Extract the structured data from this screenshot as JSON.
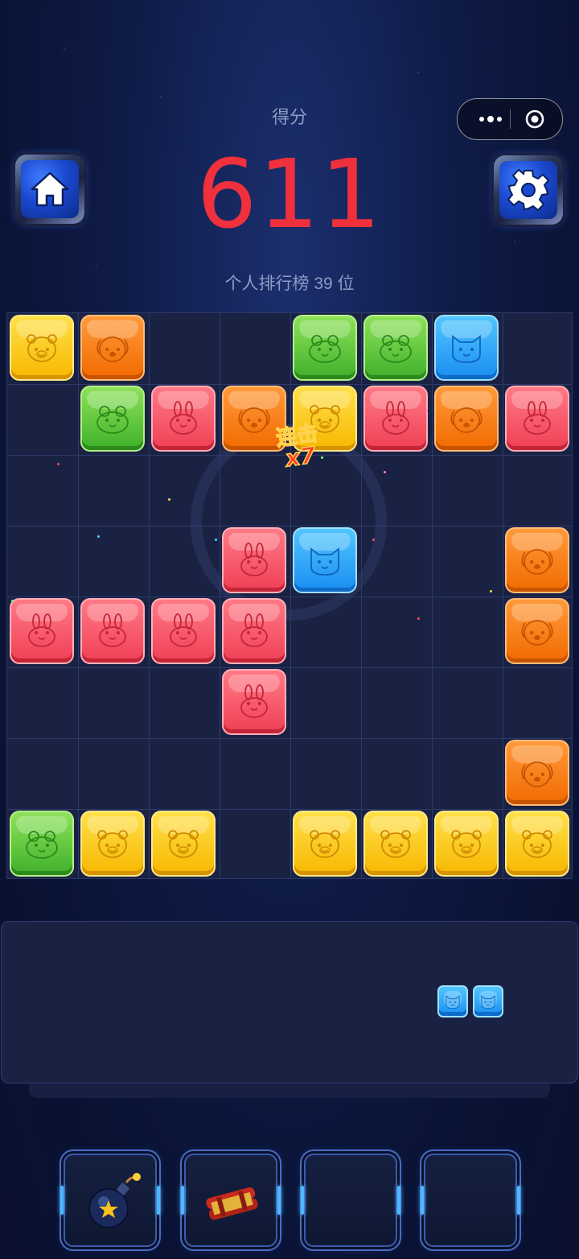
{
  "header": {
    "score_label": "得分",
    "score": "611",
    "rank_text": "个人排行榜 39 位",
    "score_color": "#f0303d"
  },
  "buttons": {
    "home_icon": "home-icon",
    "settings_icon": "gear-icon",
    "more_icon": "more-dots-icon",
    "close_icon": "target-circle-icon"
  },
  "board": {
    "rows": 8,
    "cols": 8,
    "cells": [
      [
        "yellow-bear",
        "orange-dog",
        null,
        null,
        "green-frog",
        "green-frog",
        "blue-cat",
        null
      ],
      [
        null,
        "green-frog",
        "red-rabbit",
        "orange-dog",
        "yellow-bear",
        "red-rabbit",
        "orange-dog",
        "red-rabbit"
      ],
      [
        null,
        null,
        null,
        null,
        null,
        null,
        null,
        null
      ],
      [
        null,
        null,
        null,
        "red-rabbit",
        "blue-cat",
        null,
        null,
        "orange-dog"
      ],
      [
        "red-rabbit",
        "red-rabbit",
        "red-rabbit",
        "red-rabbit",
        null,
        null,
        null,
        "orange-dog"
      ],
      [
        null,
        null,
        null,
        "red-rabbit",
        null,
        null,
        null,
        null
      ],
      [
        null,
        null,
        null,
        null,
        null,
        null,
        null,
        "orange-dog"
      ],
      [
        "green-frog",
        "yellow-bear",
        "yellow-bear",
        null,
        "yellow-bear",
        "yellow-bear",
        "yellow-bear",
        "yellow-bear"
      ]
    ],
    "combo": {
      "label": "连击",
      "multiplier": "x7"
    }
  },
  "tray": {
    "piece": [
      "blue-cat",
      "blue-cat"
    ]
  },
  "powerups": [
    {
      "name": "bomb",
      "icon": "bomb-icon"
    },
    {
      "name": "firecracker",
      "icon": "firecracker-icon"
    },
    {
      "name": "empty",
      "icon": null
    },
    {
      "name": "empty",
      "icon": null
    }
  ],
  "colors": {
    "yellow": "#f6b800",
    "orange": "#f26a00",
    "green": "#3fb02a",
    "blue": "#1a8df0",
    "red": "#ef3f55",
    "board_bg": "#1a2244"
  }
}
